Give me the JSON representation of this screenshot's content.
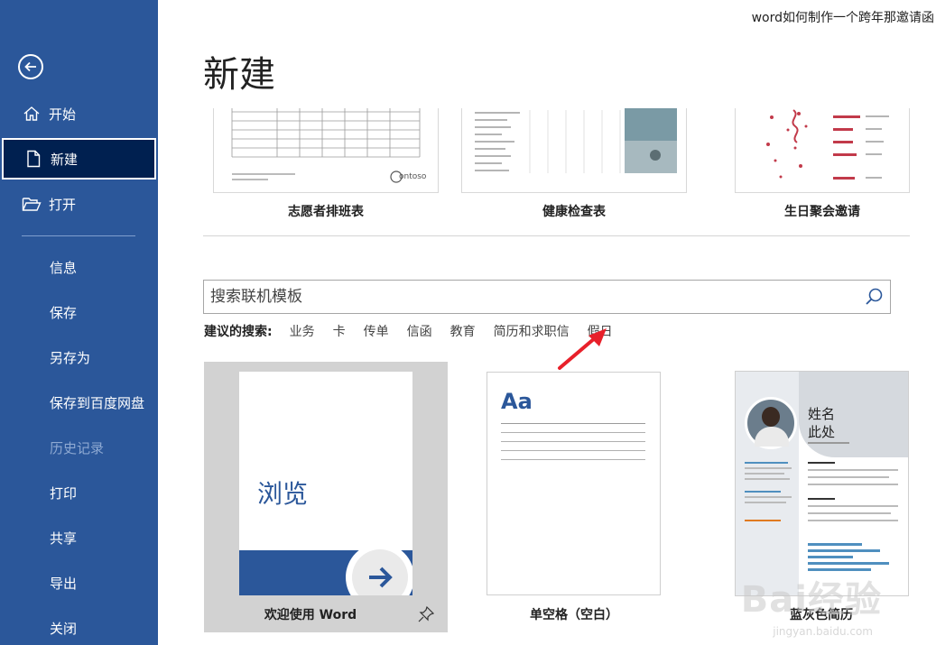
{
  "window": {
    "title": "word如何制作一个跨年那邀请函"
  },
  "sidebar": {
    "items": [
      {
        "label": "开始",
        "icon": "home-icon"
      },
      {
        "label": "新建",
        "icon": "new-document-icon",
        "active": true
      },
      {
        "label": "打开",
        "icon": "open-folder-icon"
      },
      {
        "label": "信息"
      },
      {
        "label": "保存"
      },
      {
        "label": "另存为"
      },
      {
        "label": "保存到百度网盘"
      },
      {
        "label": "历史记录",
        "disabled": true
      },
      {
        "label": "打印"
      },
      {
        "label": "共享"
      },
      {
        "label": "导出"
      },
      {
        "label": "关闭"
      }
    ]
  },
  "main": {
    "title": "新建",
    "top_templates": [
      {
        "label": "志愿者排班表",
        "logo": "ontoso"
      },
      {
        "label": "健康检查表"
      },
      {
        "label": "生日聚会邀请"
      }
    ],
    "search": {
      "placeholder": "搜索联机模板"
    },
    "suggested": {
      "lead": "建议的搜索:",
      "links": [
        "业务",
        "卡",
        "传单",
        "信函",
        "教育",
        "简历和求职信",
        "假日"
      ]
    },
    "templates": [
      {
        "label": "欢迎使用 Word",
        "thumb_text": "浏览"
      },
      {
        "label": "单空格（空白）",
        "thumb_text": "Aa"
      },
      {
        "label": "蓝灰色简历",
        "thumb_name": "姓名",
        "thumb_sub": "此处"
      }
    ]
  },
  "watermark": {
    "text": "Bai经验",
    "sub": "jingyan.baidu.com"
  },
  "colors": {
    "sidebar": "#2b579a",
    "active": "#002050",
    "accent": "#2b579a",
    "arrow": "#e8202a"
  }
}
